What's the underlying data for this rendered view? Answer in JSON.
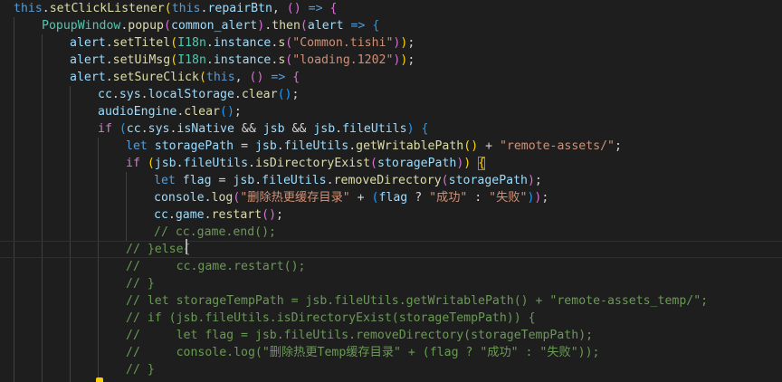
{
  "lines": [
    {
      "indent": 0,
      "tokens": [
        [
          "k",
          "this"
        ],
        [
          "p",
          "."
        ],
        [
          "f",
          "setClickListener"
        ],
        [
          "y",
          "("
        ],
        [
          "k",
          "this"
        ],
        [
          "p",
          "."
        ],
        [
          "v",
          "repairBtn"
        ],
        [
          "p",
          ", "
        ],
        [
          "m",
          "()"
        ],
        [
          "p",
          " "
        ],
        [
          "k",
          "=>"
        ],
        [
          "p",
          " "
        ],
        [
          "m",
          "{"
        ]
      ]
    },
    {
      "indent": 1,
      "tokens": [
        [
          "cl",
          "PopupWindow"
        ],
        [
          "p",
          "."
        ],
        [
          "f",
          "popup"
        ],
        [
          "m",
          "("
        ],
        [
          "v",
          "common_alert"
        ],
        [
          "m",
          ")"
        ],
        [
          "p",
          "."
        ],
        [
          "f",
          "then"
        ],
        [
          "m",
          "("
        ],
        [
          "v",
          "alert"
        ],
        [
          "p",
          " "
        ],
        [
          "k",
          "=>"
        ],
        [
          "p",
          " "
        ],
        [
          "b",
          "{"
        ]
      ]
    },
    {
      "indent": 2,
      "tokens": [
        [
          "v",
          "alert"
        ],
        [
          "p",
          "."
        ],
        [
          "f",
          "setTitel"
        ],
        [
          "y",
          "("
        ],
        [
          "cl",
          "I18n"
        ],
        [
          "p",
          "."
        ],
        [
          "v",
          "instance"
        ],
        [
          "p",
          "."
        ],
        [
          "f",
          "s"
        ],
        [
          "m",
          "("
        ],
        [
          "s",
          "\"Common.tishi\""
        ],
        [
          "m",
          ")"
        ],
        [
          "y",
          ")"
        ],
        [
          "p",
          ";"
        ]
      ]
    },
    {
      "indent": 2,
      "tokens": [
        [
          "v",
          "alert"
        ],
        [
          "p",
          "."
        ],
        [
          "f",
          "setUiMsg"
        ],
        [
          "y",
          "("
        ],
        [
          "cl",
          "I18n"
        ],
        [
          "p",
          "."
        ],
        [
          "v",
          "instance"
        ],
        [
          "p",
          "."
        ],
        [
          "f",
          "s"
        ],
        [
          "m",
          "("
        ],
        [
          "s",
          "\"loading.1202\""
        ],
        [
          "m",
          ")"
        ],
        [
          "y",
          ")"
        ],
        [
          "p",
          ";"
        ]
      ]
    },
    {
      "indent": 2,
      "tokens": [
        [
          "v",
          "alert"
        ],
        [
          "p",
          "."
        ],
        [
          "f",
          "setSureClick"
        ],
        [
          "y",
          "("
        ],
        [
          "k",
          "this"
        ],
        [
          "p",
          ", "
        ],
        [
          "m",
          "()"
        ],
        [
          "p",
          " "
        ],
        [
          "k",
          "=>"
        ],
        [
          "p",
          " "
        ],
        [
          "m",
          "{"
        ]
      ]
    },
    {
      "indent": 3,
      "tokens": [
        [
          "v",
          "cc"
        ],
        [
          "p",
          "."
        ],
        [
          "v",
          "sys"
        ],
        [
          "p",
          "."
        ],
        [
          "v",
          "localStorage"
        ],
        [
          "p",
          "."
        ],
        [
          "f",
          "clear"
        ],
        [
          "b",
          "()"
        ],
        [
          "p",
          ";"
        ]
      ]
    },
    {
      "indent": 3,
      "tokens": [
        [
          "v",
          "audioEngine"
        ],
        [
          "p",
          "."
        ],
        [
          "f",
          "clear"
        ],
        [
          "b",
          "()"
        ],
        [
          "p",
          ";"
        ]
      ]
    },
    {
      "indent": 3,
      "tokens": [
        [
          "c",
          "if"
        ],
        [
          "p",
          " "
        ],
        [
          "b",
          "("
        ],
        [
          "v",
          "cc"
        ],
        [
          "p",
          "."
        ],
        [
          "v",
          "sys"
        ],
        [
          "p",
          "."
        ],
        [
          "v",
          "isNative"
        ],
        [
          "p",
          " && "
        ],
        [
          "v",
          "jsb"
        ],
        [
          "p",
          " && "
        ],
        [
          "v",
          "jsb"
        ],
        [
          "p",
          "."
        ],
        [
          "v",
          "fileUtils"
        ],
        [
          "b",
          ")"
        ],
        [
          "p",
          " "
        ],
        [
          "b",
          "{"
        ]
      ]
    },
    {
      "indent": 4,
      "tokens": [
        [
          "k",
          "let"
        ],
        [
          "p",
          " "
        ],
        [
          "v",
          "storagePath"
        ],
        [
          "p",
          " = "
        ],
        [
          "v",
          "jsb"
        ],
        [
          "p",
          "."
        ],
        [
          "v",
          "fileUtils"
        ],
        [
          "p",
          "."
        ],
        [
          "f",
          "getWritablePath"
        ],
        [
          "y",
          "()"
        ],
        [
          "p",
          " + "
        ],
        [
          "s",
          "\"remote-assets/\""
        ],
        [
          "p",
          ";"
        ]
      ]
    },
    {
      "indent": 4,
      "tokens": [
        [
          "c",
          "if"
        ],
        [
          "p",
          " "
        ],
        [
          "y",
          "("
        ],
        [
          "v",
          "jsb"
        ],
        [
          "p",
          "."
        ],
        [
          "v",
          "fileUtils"
        ],
        [
          "p",
          "."
        ],
        [
          "f",
          "isDirectoryExist"
        ],
        [
          "m",
          "("
        ],
        [
          "v",
          "storagePath"
        ],
        [
          "m",
          ")"
        ],
        [
          "y",
          ")"
        ],
        [
          "p",
          " "
        ],
        [
          "y bm",
          "{"
        ]
      ]
    },
    {
      "indent": 5,
      "tokens": [
        [
          "k",
          "let"
        ],
        [
          "p",
          " "
        ],
        [
          "v",
          "flag"
        ],
        [
          "p",
          " = "
        ],
        [
          "v",
          "jsb"
        ],
        [
          "p",
          "."
        ],
        [
          "v",
          "fileUtils"
        ],
        [
          "p",
          "."
        ],
        [
          "f",
          "removeDirectory"
        ],
        [
          "m",
          "("
        ],
        [
          "v",
          "storagePath"
        ],
        [
          "m",
          ")"
        ],
        [
          "p",
          ";"
        ]
      ]
    },
    {
      "indent": 5,
      "tokens": [
        [
          "v",
          "console"
        ],
        [
          "p",
          "."
        ],
        [
          "f",
          "log"
        ],
        [
          "m",
          "("
        ],
        [
          "s",
          "\"删除热更缓存目录\""
        ],
        [
          "p",
          " + "
        ],
        [
          "b",
          "("
        ],
        [
          "v",
          "flag"
        ],
        [
          "p",
          " ? "
        ],
        [
          "s",
          "\"成功\""
        ],
        [
          "p",
          " : "
        ],
        [
          "s",
          "\"失败\""
        ],
        [
          "b",
          ")"
        ],
        [
          "m",
          ")"
        ],
        [
          "p",
          ";"
        ]
      ]
    },
    {
      "indent": 5,
      "tokens": [
        [
          "v",
          "cc"
        ],
        [
          "p",
          "."
        ],
        [
          "v",
          "game"
        ],
        [
          "p",
          "."
        ],
        [
          "f",
          "restart"
        ],
        [
          "m",
          "()"
        ],
        [
          "p",
          ";"
        ]
      ]
    },
    {
      "indent": 5,
      "tokens": [
        [
          "cm",
          "// cc.game.end();"
        ]
      ]
    },
    {
      "indent": 4,
      "tokens": [
        [
          "cm",
          "// }else{"
        ]
      ],
      "current": true
    },
    {
      "indent": 4,
      "tokens": [
        [
          "cm",
          "//     cc.game.restart();"
        ]
      ]
    },
    {
      "indent": 4,
      "tokens": [
        [
          "cm",
          "// }"
        ]
      ]
    },
    {
      "indent": 4,
      "tokens": [
        [
          "cm",
          "// let storageTempPath = jsb.fileUtils.getWritablePath() + \"remote-assets_temp/\";"
        ]
      ]
    },
    {
      "indent": 4,
      "tokens": [
        [
          "cm",
          "// if (jsb.fileUtils.isDirectoryExist(storageTempPath)) {"
        ]
      ]
    },
    {
      "indent": 4,
      "tokens": [
        [
          "cm",
          "//     let flag = jsb.fileUtils.removeDirectory(storageTempPath);"
        ]
      ]
    },
    {
      "indent": 4,
      "tokens": [
        [
          "cm",
          "//     console.log(\"删除热更Temp缓存目录\" + (flag ? \"成功\" : \"失败\"));"
        ]
      ]
    },
    {
      "indent": 4,
      "tokens": [
        [
          "cm",
          "// }"
        ]
      ]
    }
  ],
  "colors": {
    "background": "#1e1e1e",
    "keyword": "#569cd6",
    "control": "#c586c0",
    "function": "#dcdcaa",
    "variable": "#9cdcfe",
    "class": "#4ec9b0",
    "string": "#ce9178",
    "comment": "#6a9955",
    "bracket_gold": "#ffd700",
    "bracket_magenta": "#da70d6",
    "bracket_blue": "#179fff"
  },
  "icons": {
    "cursor": "text-cursor-icon",
    "lightbulb": "lightbulb-icon"
  }
}
